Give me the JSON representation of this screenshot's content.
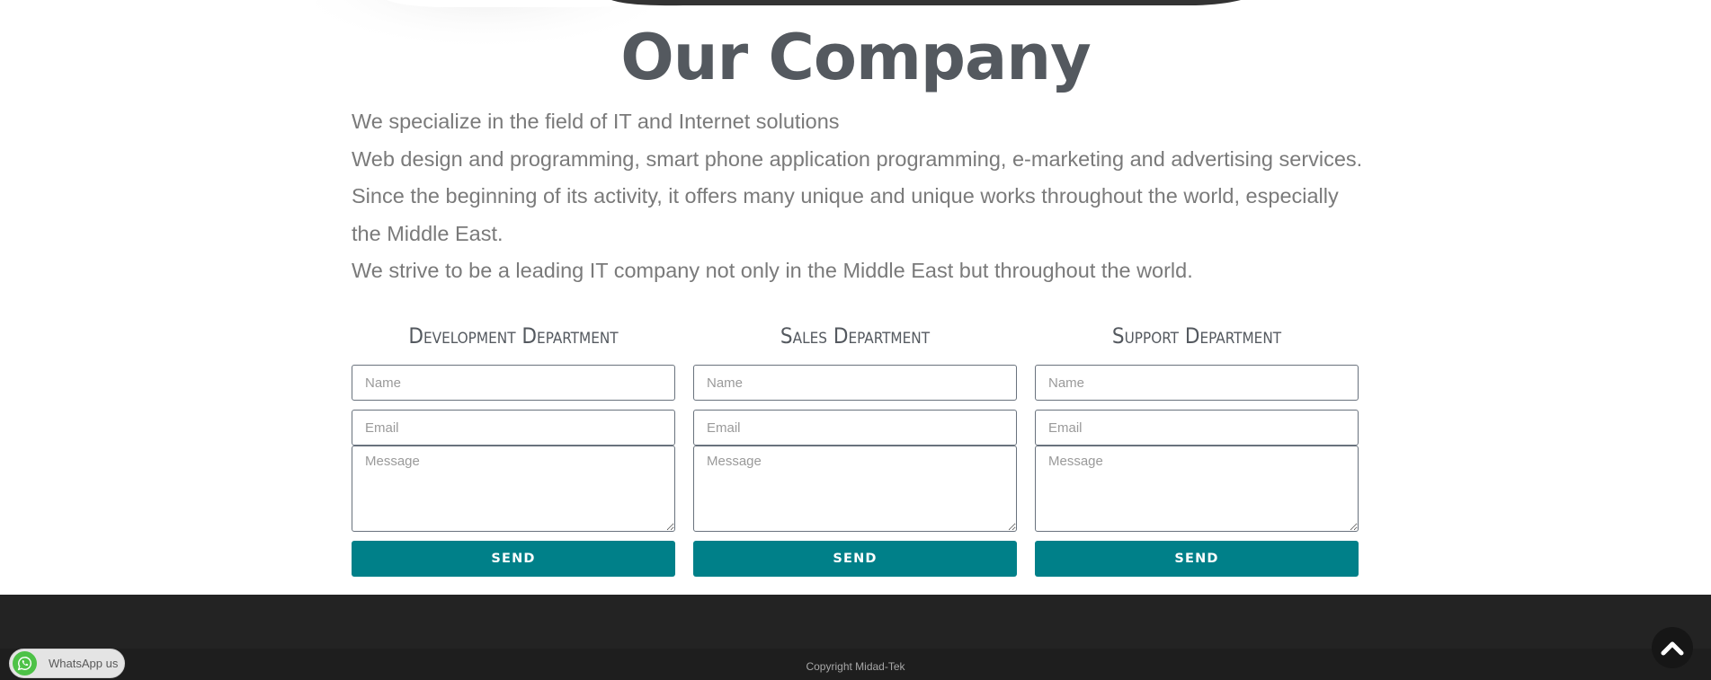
{
  "page": {
    "title": "Our Company",
    "intro": [
      "We specialize in the field of IT and Internet solutions",
      "Web design and programming, smart phone application programming, e-marketing and advertising services.",
      "Since the beginning of its activity, it offers many unique and unique works throughout the world, especially the Middle East.",
      "We strive to be a leading IT company not only in the Middle East but throughout the world."
    ]
  },
  "departments": [
    {
      "title": "Development Department",
      "name_placeholder": "Name",
      "email_placeholder": "Email",
      "message_placeholder": "Message",
      "send_label": "SEND"
    },
    {
      "title": "Sales Department",
      "name_placeholder": "Name",
      "email_placeholder": "Email",
      "message_placeholder": "Message",
      "send_label": "SEND"
    },
    {
      "title": "Support Department",
      "name_placeholder": "Name",
      "email_placeholder": "Email",
      "message_placeholder": "Message",
      "send_label": "SEND"
    }
  ],
  "footer": {
    "copyright": "Copyright Midad-Tek"
  },
  "whatsapp": {
    "label": "WhatsApp us",
    "icon": "whatsapp-icon"
  },
  "scroll_top": {
    "icon": "chevron-up-icon"
  },
  "colors": {
    "accent": "#008089",
    "title": "#54595f",
    "body_text": "#7a7a7a",
    "footer": "#232323",
    "whatsapp_green": "#4dc247"
  }
}
